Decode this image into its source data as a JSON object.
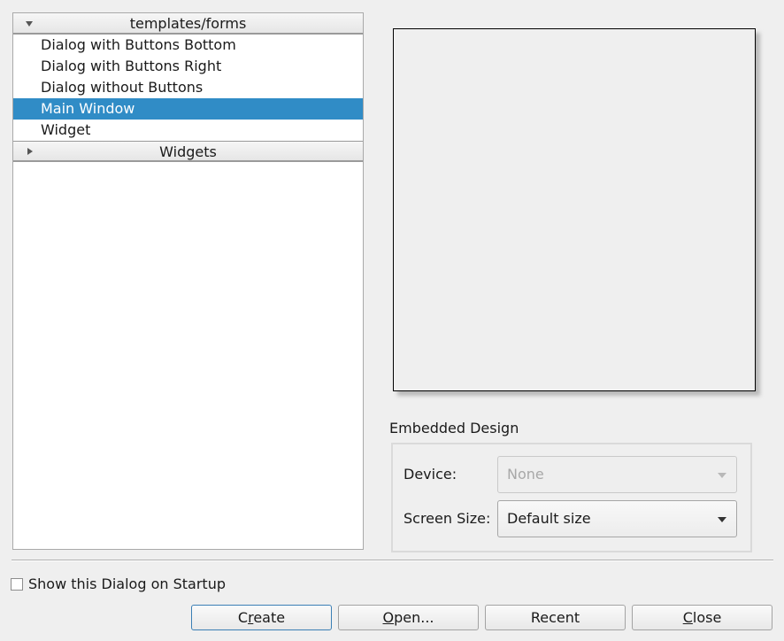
{
  "tree": {
    "groups": [
      {
        "label": "templates/forms",
        "expanded": true,
        "items": [
          {
            "label": "Dialog with Buttons Bottom",
            "selected": false
          },
          {
            "label": "Dialog with Buttons Right",
            "selected": false
          },
          {
            "label": "Dialog without Buttons",
            "selected": false
          },
          {
            "label": "Main Window",
            "selected": true
          },
          {
            "label": "Widget",
            "selected": false
          }
        ]
      },
      {
        "label": "Widgets",
        "expanded": false,
        "items": []
      }
    ]
  },
  "embedded": {
    "title": "Embedded Design",
    "device_label": "Device:",
    "device_value": "None",
    "device_enabled": false,
    "screen_size_label": "Screen Size:",
    "screen_size_value": "Default size"
  },
  "startup_checkbox": {
    "label": "Show this Dialog on Startup",
    "checked": false
  },
  "buttons": {
    "create": {
      "pre": "C",
      "mnemonic": "r",
      "post": "eate"
    },
    "open": {
      "pre": "",
      "mnemonic": "O",
      "post": "pen..."
    },
    "recent": {
      "label": "Recent"
    },
    "close": {
      "pre": "",
      "mnemonic": "C",
      "post": "lose"
    }
  },
  "colors": {
    "selection": "#308cc6",
    "background": "#efefef"
  }
}
